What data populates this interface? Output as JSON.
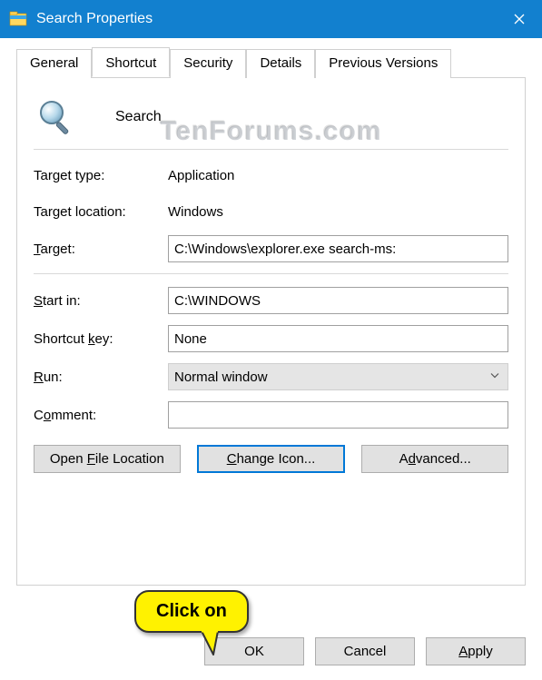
{
  "window": {
    "title": "Search Properties"
  },
  "tabs": {
    "general": "General",
    "shortcut": "Shortcut",
    "security": "Security",
    "details": "Details",
    "previous": "Previous Versions"
  },
  "panel": {
    "shortcut_name": "Search",
    "target_type_label": "Target type:",
    "target_type_value": "Application",
    "target_location_label": "Target location:",
    "target_location_value": "Windows",
    "target_label_pre": "",
    "target_label_u": "T",
    "target_label_post": "arget:",
    "target_value": "C:\\Windows\\explorer.exe search-ms:",
    "startin_label_pre": "",
    "startin_label_u": "S",
    "startin_label_post": "tart in:",
    "startin_value": "C:\\WINDOWS",
    "shortcutkey_label_pre": "Shortcut ",
    "shortcutkey_label_u": "k",
    "shortcutkey_label_post": "ey:",
    "shortcutkey_value": "None",
    "run_label_pre": "",
    "run_label_u": "R",
    "run_label_post": "un:",
    "run_value": "Normal window",
    "comment_label_pre": "C",
    "comment_label_u": "o",
    "comment_label_post": "mment:",
    "comment_value": ""
  },
  "buttons": {
    "open_file_pre": "Open ",
    "open_file_u": "F",
    "open_file_post": "ile Location",
    "change_icon_pre": "",
    "change_icon_u": "C",
    "change_icon_post": "hange Icon...",
    "advanced_pre": "A",
    "advanced_u": "d",
    "advanced_post": "vanced...",
    "ok": "OK",
    "cancel": "Cancel",
    "apply_pre": "",
    "apply_u": "A",
    "apply_post": "pply"
  },
  "callout": {
    "text": "Click on"
  },
  "watermark": "TenForums.com"
}
